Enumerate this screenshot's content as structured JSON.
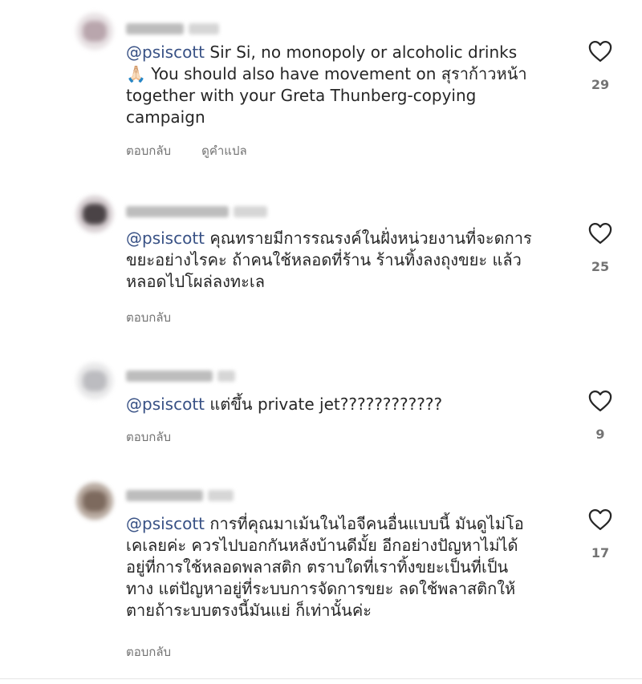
{
  "comments": [
    {
      "mention": "@psiscott",
      "lines": [
        " Sir Si, no monopoly or alcoholic drinks",
        "🙏🏻 You should also have movement on สุราก้าวหน้า",
        "together with your Greta Thunberg-copying",
        "campaign"
      ],
      "actions": [
        "ตอบกลับ",
        "ดูคำแปล"
      ],
      "likes": "29",
      "avatar_colors": [
        "#e8e2e4",
        "#b9a6ad"
      ]
    },
    {
      "mention": "@psiscott",
      "lines": [
        " คุณทรายมีการรณรงค์ในฝั่งหน่วยงานที่จะดการ",
        "ขยะอย่างไรคะ ถ้าคนใช้หลอดที่ร้าน ร้านทิ้งลงถุงขยะ แล้ว",
        "หลอดไปโผล่ลงทะเล"
      ],
      "actions": [
        "ตอบกลับ"
      ],
      "likes": "25",
      "avatar_colors": [
        "#d7cfd2",
        "#4a4346"
      ]
    },
    {
      "mention": "@psiscott",
      "lines": [
        " แต่ขึ้น private jet????????????"
      ],
      "actions": [
        "ตอบกลับ"
      ],
      "likes": "9",
      "avatar_colors": [
        "#e9e9ea",
        "#bcbcc0"
      ]
    },
    {
      "mention": "@psiscott",
      "lines": [
        " การที่คุณมาเม้นในไอจีคนอื่นแบบนี้ มันดูไม่โอ",
        "เคเลยค่ะ ควรไปบอกกันหลังบ้านดีมั้ย อีกอย่างปัญหาไม่ได้",
        "อยู่ที่การใช้หลอดพลาสติก ตราบใดที่เราทิ้งขยะเป็นที่เป็น",
        "ทาง แต่ปัญหาอยู่ที่ระบบการจัดการขยะ ลดใช้พลาสติกให้",
        "ตายถ้าระบบตรงนี้มันแย่ ก็เท่านั้นค่ะ"
      ],
      "actions": [
        "ตอบกลับ"
      ],
      "likes": "17",
      "avatar_colors": [
        "#b8aaa0",
        "#7d6a5e"
      ]
    }
  ],
  "heart_color": "#262626"
}
